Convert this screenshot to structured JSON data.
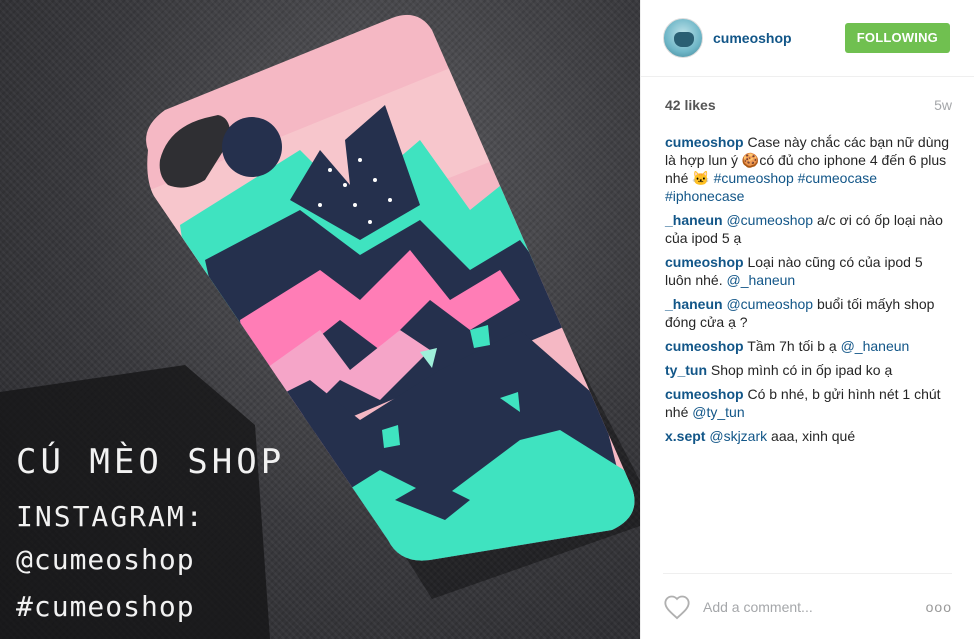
{
  "photo": {
    "overlay": {
      "title": "CÚ MÈO SHOP",
      "subtitle": "INSTAGRAM:",
      "handle": "@cumeoshop",
      "hashtag": "#cumeoshop"
    }
  },
  "header": {
    "username": "cumeoshop",
    "follow_label": "FOLLOWING"
  },
  "meta": {
    "likes": "42 likes",
    "age": "5w"
  },
  "comments": [
    {
      "user": "cumeoshop",
      "parts": [
        {
          "t": "text",
          "v": " Case này chắc các bạn nữ dùng là hợp lun ý 🍪có đủ cho iphone 4 đến 6 plus nhé 🐱 "
        },
        {
          "t": "tag",
          "v": "#cumeoshop"
        },
        {
          "t": "text",
          "v": " "
        },
        {
          "t": "tag",
          "v": "#cumeocase"
        },
        {
          "t": "text",
          "v": " "
        },
        {
          "t": "tag",
          "v": "#iphonecase"
        }
      ]
    },
    {
      "user": "_haneun",
      "parts": [
        {
          "t": "text",
          "v": " "
        },
        {
          "t": "tag",
          "v": "@cumeoshop"
        },
        {
          "t": "text",
          "v": " a/c ơi có ốp loại nào của ipod 5 ạ"
        }
      ]
    },
    {
      "user": "cumeoshop",
      "parts": [
        {
          "t": "text",
          "v": " Loại nào cũng có của ipod 5 luôn nhé. "
        },
        {
          "t": "tag",
          "v": "@_haneun"
        }
      ]
    },
    {
      "user": "_haneun",
      "parts": [
        {
          "t": "text",
          "v": " "
        },
        {
          "t": "tag",
          "v": "@cumeoshop"
        },
        {
          "t": "text",
          "v": " buổi tối mấyh shop đóng cửa ạ ?"
        }
      ]
    },
    {
      "user": "cumeoshop",
      "parts": [
        {
          "t": "text",
          "v": " Tầm 7h tối b ạ "
        },
        {
          "t": "tag",
          "v": "@_haneun"
        }
      ]
    },
    {
      "user": "ty_tun",
      "parts": [
        {
          "t": "text",
          "v": " Shop mình có in ốp ipad ko ạ"
        }
      ]
    },
    {
      "user": "cumeoshop",
      "parts": [
        {
          "t": "text",
          "v": " Có b nhé, b gửi hình nét 1 chút nhé "
        },
        {
          "t": "tag",
          "v": "@ty_tun"
        }
      ]
    },
    {
      "user": "x.sept",
      "parts": [
        {
          "t": "text",
          "v": " "
        },
        {
          "t": "tag",
          "v": "@skjzark"
        },
        {
          "t": "text",
          "v": " aaa, xinh qué"
        }
      ]
    }
  ],
  "footer": {
    "comment_placeholder": "Add a comment...",
    "more_label": "ooo"
  },
  "colors": {
    "follow_green": "#70c050",
    "link_blue": "#125688",
    "case_pink": "#f5b8c4",
    "case_navy": "#25304d",
    "case_mint": "#3fe3c0"
  },
  "icons": {
    "like": "heart-outline-icon",
    "more": "ellipsis-icon"
  }
}
